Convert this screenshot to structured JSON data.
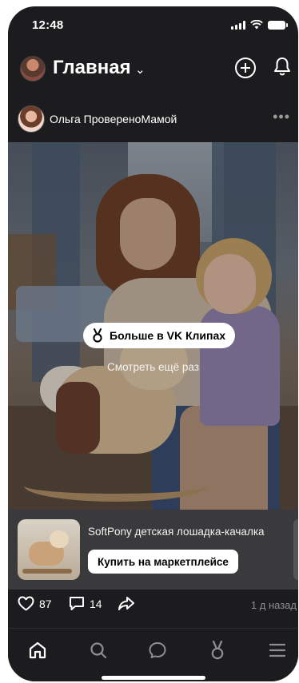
{
  "status_bar": {
    "time": "12:48"
  },
  "header": {
    "title": "Главная",
    "chevron": "⌄"
  },
  "post": {
    "author": "Ольга ПровереноМамой",
    "more": "•••",
    "video": {
      "clips_button": "Больше в VK Клипах",
      "watch_again": "Смотреть ещё раз"
    },
    "product": {
      "title": "SoftPony детская лошадка-качалка",
      "buy_button": "Купить на маркетплейсе"
    },
    "reactions": {
      "likes": "87",
      "comments": "14",
      "date": "1 д назад"
    }
  },
  "nav": {
    "items": [
      "home-icon",
      "search-icon",
      "messages-icon",
      "clips-icon",
      "menu-icon"
    ],
    "active": "home-icon"
  },
  "colors": {
    "background": "#1c1c1e",
    "product_bg": "#3a3a3c",
    "muted": "#8e8e93"
  }
}
